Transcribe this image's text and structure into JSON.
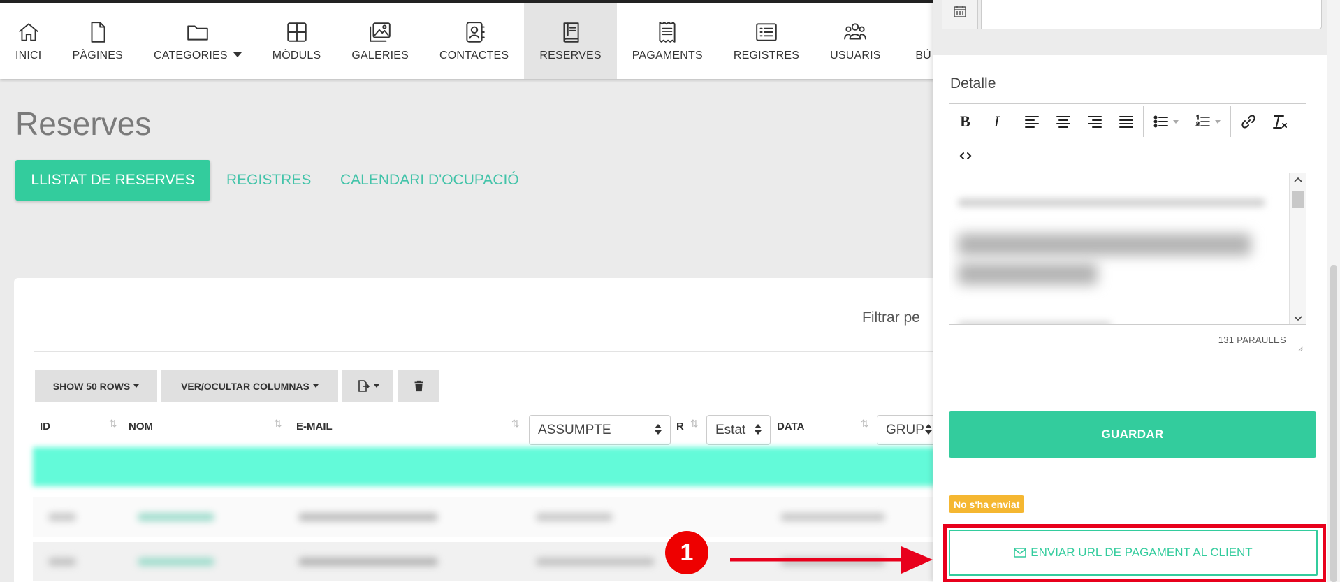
{
  "nav": {
    "items": [
      {
        "label": "INICI",
        "icon": "home-icon"
      },
      {
        "label": "PÀGINES",
        "icon": "page-icon"
      },
      {
        "label": "CATEGORIES",
        "icon": "folder-icon"
      },
      {
        "label": "MÒDULS",
        "icon": "grid-icon"
      },
      {
        "label": "GALERIES",
        "icon": "gallery-icon"
      },
      {
        "label": "CONTACTES",
        "icon": "contacts-icon"
      },
      {
        "label": "RESERVES",
        "icon": "book-icon"
      },
      {
        "label": "PAGAMENTS",
        "icon": "receipt-icon"
      },
      {
        "label": "REGISTRES",
        "icon": "list-icon"
      },
      {
        "label": "USUARIS",
        "icon": "users-icon"
      },
      {
        "label": "BÚ",
        "icon": "search-icon"
      }
    ],
    "active": "RESERVES"
  },
  "page": {
    "title": "Reserves",
    "tabs": [
      "LLISTAT DE RESERVES",
      "REGISTRES",
      "CALENDARI D'OCUPACIÓ"
    ]
  },
  "table": {
    "filter_label": "Filtrar pe",
    "toolbar": {
      "show_rows": "SHOW 50 ROWS",
      "columns": "VER/OCULTAR COLUMNAS"
    },
    "headers": {
      "id": "ID",
      "nom": "NOM",
      "email": "E-MAIL",
      "assumpte": "ASSUMPTE",
      "r": "R",
      "estat": "Estat",
      "data": "DATA",
      "grup": "GRUP"
    }
  },
  "panel": {
    "detalle_label": "Detalle",
    "word_count": "131 PARAULES",
    "save_label": "GUARDAR",
    "status_badge": "No s'ha enviat",
    "send_label": "ENVIAR URL DE PAGAMENT AL CLIENT"
  },
  "annotation": {
    "step": "1",
    "color": "#e8001c"
  },
  "colors": {
    "accent": "#33cc9d",
    "badge": "#f5b731",
    "highlight_row": "#63fad9"
  }
}
